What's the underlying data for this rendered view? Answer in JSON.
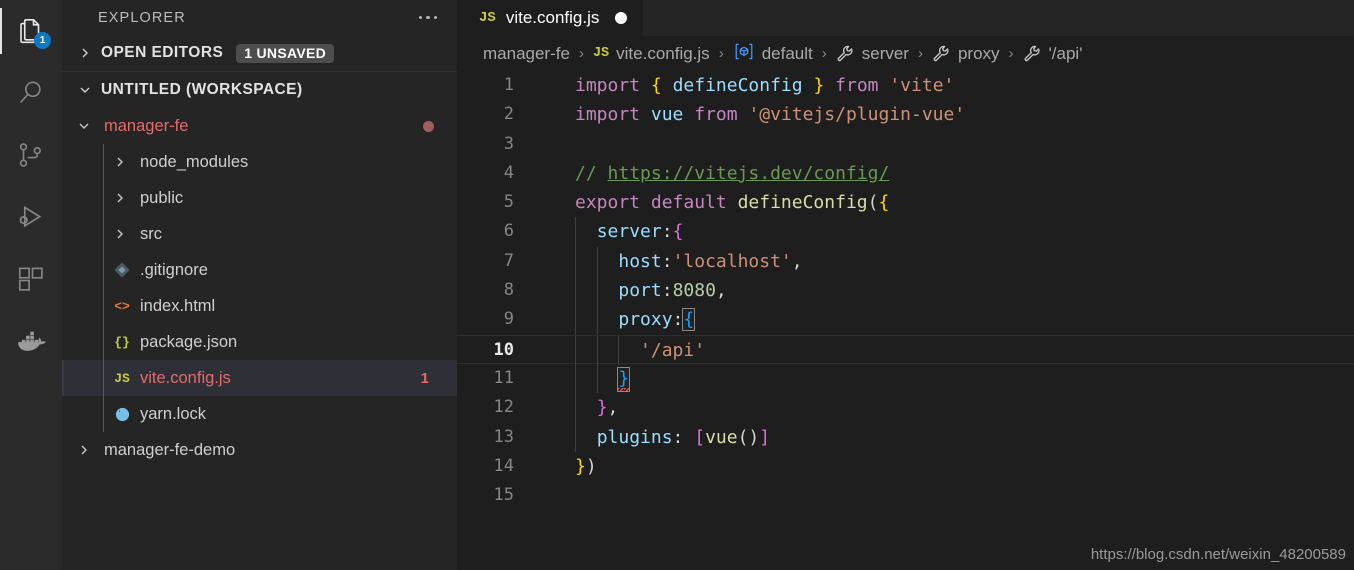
{
  "activity_bar": {
    "items": [
      {
        "name": "explorer",
        "icon": "files-icon",
        "active": true,
        "badge": "1"
      },
      {
        "name": "search",
        "icon": "search-icon",
        "active": false,
        "badge": ""
      },
      {
        "name": "source-control",
        "icon": "source-control-icon",
        "active": false,
        "badge": ""
      },
      {
        "name": "run-and-debug",
        "icon": "run-debug-icon",
        "active": false,
        "badge": ""
      },
      {
        "name": "extensions",
        "icon": "extensions-icon",
        "active": false,
        "badge": ""
      },
      {
        "name": "docker",
        "icon": "docker-icon",
        "active": false,
        "badge": ""
      }
    ]
  },
  "sidebar": {
    "title": "EXPLORER",
    "more_actions": "ellipsis-icon",
    "open_editors": {
      "label": "OPEN EDITORS",
      "badge": "1 UNSAVED",
      "expanded": false
    },
    "workspace": {
      "label": "UNTITLED (WORKSPACE)",
      "expanded": true
    },
    "tree": [
      {
        "label": "manager-fe",
        "kind": "folder",
        "expanded": true,
        "depth": 1,
        "color": "error",
        "dot_badge": true,
        "count": ""
      },
      {
        "label": "node_modules",
        "kind": "folder",
        "expanded": false,
        "depth": 2,
        "color": "normal",
        "dot_badge": false,
        "count": ""
      },
      {
        "label": "public",
        "kind": "folder",
        "expanded": false,
        "depth": 2,
        "color": "normal",
        "dot_badge": false,
        "count": ""
      },
      {
        "label": "src",
        "kind": "folder",
        "expanded": false,
        "depth": 2,
        "color": "normal",
        "dot_badge": false,
        "count": ""
      },
      {
        "label": ".gitignore",
        "kind": "git",
        "expanded": false,
        "depth": 2,
        "color": "normal",
        "dot_badge": false,
        "count": ""
      },
      {
        "label": "index.html",
        "kind": "html",
        "expanded": false,
        "depth": 2,
        "color": "normal",
        "dot_badge": false,
        "count": ""
      },
      {
        "label": "package.json",
        "kind": "json",
        "expanded": false,
        "depth": 2,
        "color": "normal",
        "dot_badge": false,
        "count": ""
      },
      {
        "label": "vite.config.js",
        "kind": "js",
        "expanded": false,
        "depth": 2,
        "color": "error",
        "dot_badge": false,
        "count": "1",
        "selected": true
      },
      {
        "label": "yarn.lock",
        "kind": "yarn",
        "expanded": false,
        "depth": 2,
        "color": "normal",
        "dot_badge": false,
        "count": ""
      },
      {
        "label": "manager-fe-demo",
        "kind": "folder",
        "expanded": false,
        "depth": 1,
        "color": "normal",
        "dot_badge": false,
        "count": ""
      }
    ]
  },
  "editor": {
    "tab": {
      "icon": "js-file-icon",
      "icon_label": "JS",
      "title": "vite.config.js",
      "dirty": true
    },
    "breadcrumb": [
      {
        "label": "manager-fe",
        "icon": ""
      },
      {
        "label": "vite.config.js",
        "icon": "js-file-icon",
        "icon_label": "JS"
      },
      {
        "label": "default",
        "icon": "export-symbol-icon"
      },
      {
        "label": "server",
        "icon": "property-wrench-icon"
      },
      {
        "label": "proxy",
        "icon": "property-wrench-icon"
      },
      {
        "label": "'/api'",
        "icon": "property-wrench-icon"
      }
    ],
    "breadcrumb_separator": "›",
    "active_line": 10,
    "total_lines": 15,
    "lines": [
      {
        "n": 1,
        "guides": 0,
        "tokens": [
          {
            "t": "import",
            "c": "t-kw"
          },
          {
            "t": " ",
            "c": ""
          },
          {
            "t": "{",
            "c": "t-brace1"
          },
          {
            "t": " ",
            "c": ""
          },
          {
            "t": "defineConfig",
            "c": "t-var"
          },
          {
            "t": " ",
            "c": ""
          },
          {
            "t": "}",
            "c": "t-brace1"
          },
          {
            "t": " ",
            "c": ""
          },
          {
            "t": "from",
            "c": "t-kw"
          },
          {
            "t": " ",
            "c": ""
          },
          {
            "t": "'vite'",
            "c": "t-str"
          }
        ]
      },
      {
        "n": 2,
        "guides": 0,
        "tokens": [
          {
            "t": "import",
            "c": "t-kw"
          },
          {
            "t": " ",
            "c": ""
          },
          {
            "t": "vue",
            "c": "t-var"
          },
          {
            "t": " ",
            "c": ""
          },
          {
            "t": "from",
            "c": "t-kw"
          },
          {
            "t": " ",
            "c": ""
          },
          {
            "t": "'@vitejs/plugin-vue'",
            "c": "t-str"
          }
        ]
      },
      {
        "n": 3,
        "guides": 0,
        "tokens": []
      },
      {
        "n": 4,
        "guides": 0,
        "tokens": [
          {
            "t": "// ",
            "c": "t-com"
          },
          {
            "t": "https://vitejs.dev/config/",
            "c": "t-link"
          }
        ]
      },
      {
        "n": 5,
        "guides": 0,
        "tokens": [
          {
            "t": "export",
            "c": "t-kw"
          },
          {
            "t": " ",
            "c": ""
          },
          {
            "t": "default",
            "c": "t-kw"
          },
          {
            "t": " ",
            "c": ""
          },
          {
            "t": "defineConfig",
            "c": "t-fn"
          },
          {
            "t": "(",
            "c": "t-punct"
          },
          {
            "t": "{",
            "c": "t-brace1"
          }
        ]
      },
      {
        "n": 6,
        "guides": 1,
        "tokens": [
          {
            "t": "  ",
            "c": ""
          },
          {
            "t": "server",
            "c": "t-prop"
          },
          {
            "t": ":",
            "c": "t-punct"
          },
          {
            "t": "{",
            "c": "t-brace2"
          }
        ]
      },
      {
        "n": 7,
        "guides": 2,
        "tokens": [
          {
            "t": "    ",
            "c": ""
          },
          {
            "t": "host",
            "c": "t-prop"
          },
          {
            "t": ":",
            "c": "t-punct"
          },
          {
            "t": "'localhost'",
            "c": "t-str"
          },
          {
            "t": ",",
            "c": "t-punct"
          }
        ]
      },
      {
        "n": 8,
        "guides": 2,
        "tokens": [
          {
            "t": "    ",
            "c": ""
          },
          {
            "t": "port",
            "c": "t-prop"
          },
          {
            "t": ":",
            "c": "t-punct"
          },
          {
            "t": "8080",
            "c": "t-num"
          },
          {
            "t": ",",
            "c": "t-punct"
          }
        ]
      },
      {
        "n": 9,
        "guides": 2,
        "tokens": [
          {
            "t": "    ",
            "c": ""
          },
          {
            "t": "proxy",
            "c": "t-prop"
          },
          {
            "t": ":",
            "c": "t-punct"
          },
          {
            "t": "{",
            "c": "t-brace3 bracket-match"
          }
        ]
      },
      {
        "n": 10,
        "guides": 3,
        "tokens": [
          {
            "t": "      ",
            "c": ""
          },
          {
            "t": "'/api'",
            "c": "t-str"
          }
        ]
      },
      {
        "n": 11,
        "guides": 2,
        "tokens": [
          {
            "t": "    ",
            "c": ""
          },
          {
            "t": "}",
            "c": "t-brace3 bracket-match squiggle"
          }
        ]
      },
      {
        "n": 12,
        "guides": 1,
        "tokens": [
          {
            "t": "  ",
            "c": ""
          },
          {
            "t": "}",
            "c": "t-brace2"
          },
          {
            "t": ",",
            "c": "t-punct"
          }
        ]
      },
      {
        "n": 13,
        "guides": 1,
        "tokens": [
          {
            "t": "  ",
            "c": ""
          },
          {
            "t": "plugins",
            "c": "t-prop"
          },
          {
            "t": ":",
            "c": "t-punct"
          },
          {
            "t": " ",
            "c": ""
          },
          {
            "t": "[",
            "c": "t-brace2"
          },
          {
            "t": "vue",
            "c": "t-fn"
          },
          {
            "t": "()",
            "c": "t-punct"
          },
          {
            "t": "]",
            "c": "t-brace2"
          }
        ]
      },
      {
        "n": 14,
        "guides": 0,
        "tokens": [
          {
            "t": "}",
            "c": "t-brace1"
          },
          {
            "t": ")",
            "c": "t-punct"
          }
        ]
      },
      {
        "n": 15,
        "guides": 0,
        "tokens": []
      }
    ]
  },
  "watermark": "https://blog.csdn.net/weixin_48200589",
  "colors": {
    "accent_badge": "#0e79c4",
    "error_text": "#e06c6c",
    "editor_bg": "#1e1e1e",
    "sidebar_bg": "#252526",
    "activity_bg": "#2b2b2b",
    "selected_row": "#2f2f37"
  }
}
